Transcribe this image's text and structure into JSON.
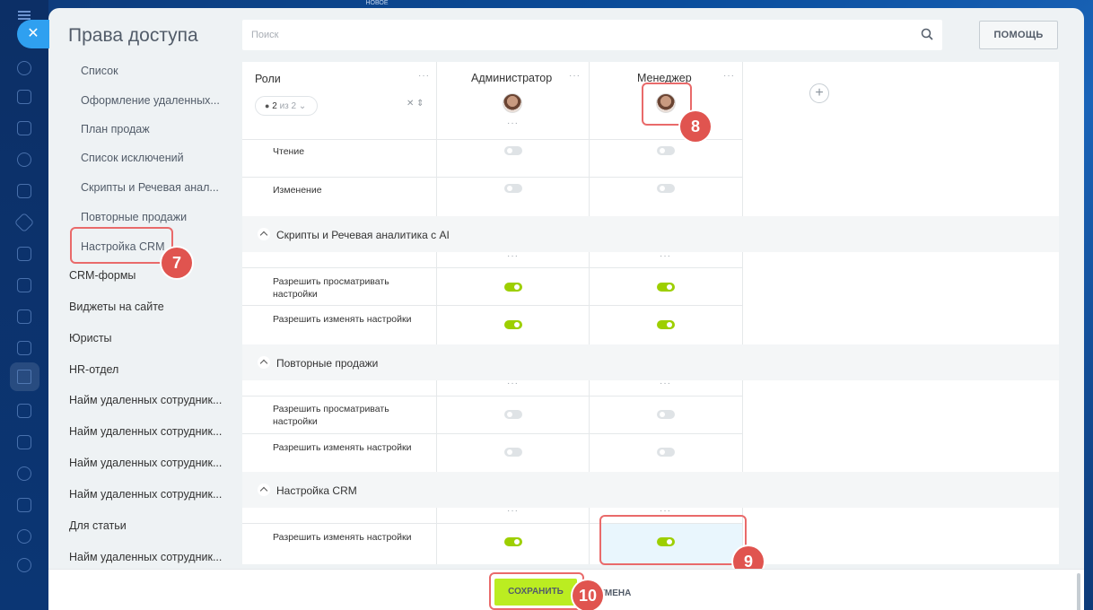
{
  "header": {
    "title": "Права доступа",
    "search_placeholder": "Поиск",
    "help_label": "ПОМОЩЬ",
    "close_glyph": "✕",
    "backdrop_caption": "НОВОЕ"
  },
  "sidebar": {
    "sub_items": [
      "Список",
      "Оформление удаленных...",
      "План продаж",
      "Список исключений",
      "Скрипты и Речевая анал...",
      "Повторные продажи",
      "Настройка CRM"
    ],
    "top_items": [
      "CRM-формы",
      "Виджеты на сайте",
      "Юристы",
      "HR-отдел",
      "Найм удаленных сотрудник...",
      "Найм удаленных сотрудник...",
      "Найм удаленных сотрудник...",
      "Найм удаленных сотрудник...",
      "Для статьи",
      "Найм удаленных сотрудник..."
    ]
  },
  "table": {
    "roles_label": "Роли",
    "pager_current": "2",
    "pager_total": "из 2",
    "dots": "···",
    "columns": [
      {
        "name": "Администратор"
      },
      {
        "name": "Менеджер"
      }
    ],
    "rows_top": [
      {
        "label": "Чтение",
        "admin": "off",
        "manager": "off"
      },
      {
        "label": "Изменение",
        "admin": "off",
        "manager": "off"
      }
    ],
    "sections": [
      {
        "title": "Скрипты и Речевая аналитика с AI",
        "rows": [
          {
            "label": "Разрешить просматривать настройки",
            "admin": "on",
            "manager": "on"
          },
          {
            "label": "Разрешить изменять настройки",
            "admin": "on",
            "manager": "on"
          }
        ]
      },
      {
        "title": "Повторные продажи",
        "rows": [
          {
            "label": "Разрешить просматривать настройки",
            "admin": "off",
            "manager": "off"
          },
          {
            "label": "Разрешить изменять настройки",
            "admin": "off",
            "manager": "off"
          }
        ]
      },
      {
        "title": "Настройка CRM",
        "rows": [
          {
            "label": "Разрешить изменять настройки",
            "admin": "on",
            "manager": "on"
          }
        ]
      }
    ]
  },
  "footer": {
    "save_label": "СОХРАНИТЬ",
    "cancel_label": "ОТМЕНА"
  },
  "annotations": [
    "7",
    "8",
    "9",
    "10"
  ],
  "colors": {
    "toggle_on": "#9dcf00",
    "toggle_off": "#dfe3e6",
    "save_button": "#bbed21",
    "highlight": "#e96a6a",
    "badge": "#e0544f"
  }
}
